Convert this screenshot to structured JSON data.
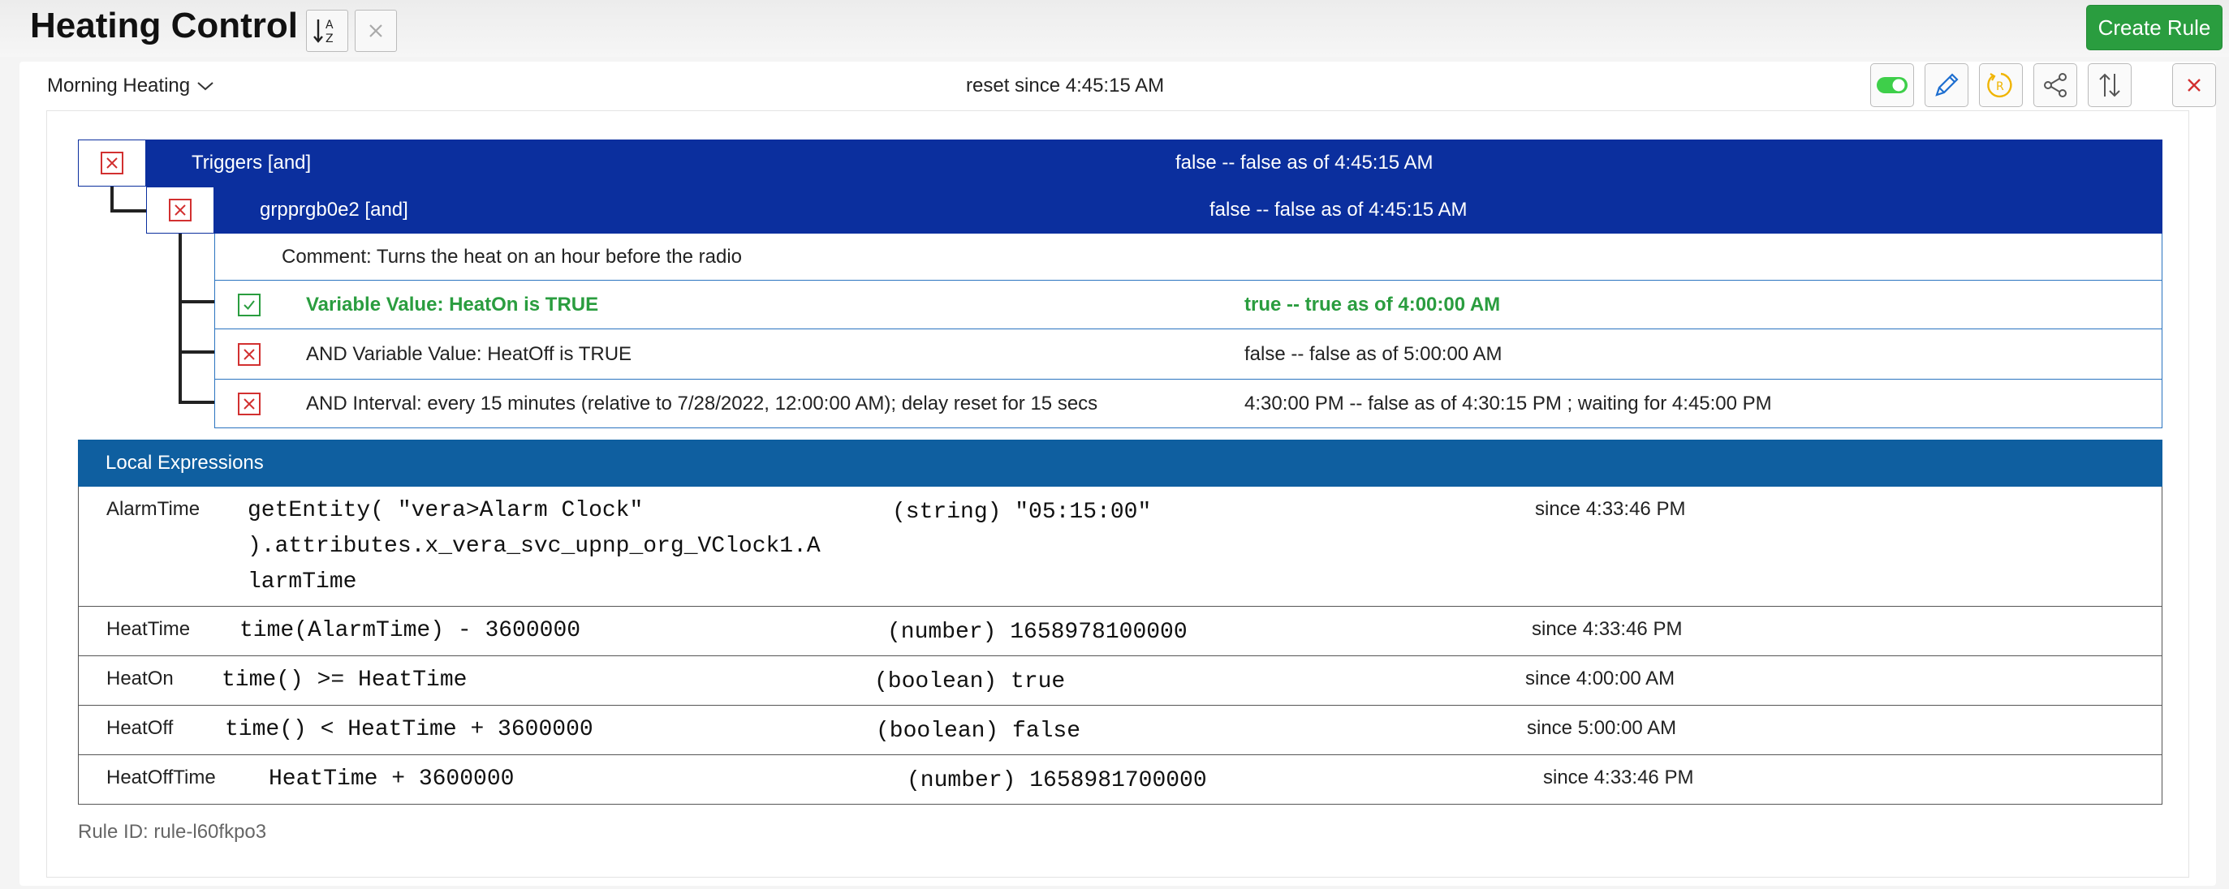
{
  "app": {
    "title": "Heating Control",
    "create_rule_label": "Create Rule"
  },
  "rule": {
    "name": "Morning Heating",
    "status": "reset since 4:45:15 AM",
    "id_text": "Rule ID: rule-l60fkpo3"
  },
  "triggers": {
    "root": {
      "label": "Triggers [and]",
      "state": "false -- false as of 4:45:15 AM"
    },
    "group": {
      "label": "grpprgb0e2 [and]",
      "state": "false -- false as of 4:45:15 AM"
    },
    "comment": "Comment: Turns the heat on an hour before the radio",
    "conditions": [
      {
        "label": "Variable Value: HeatOn is TRUE",
        "state": "true -- true as of 4:00:00 AM",
        "ok": true
      },
      {
        "label": "AND Variable Value: HeatOff is TRUE",
        "state": "false -- false as of 5:00:00 AM",
        "ok": false
      },
      {
        "label": "AND Interval: every 15 minutes (relative to 7/28/2022, 12:00:00 AM); delay reset for 15 secs",
        "state": "4:30:00 PM -- false as of 4:30:15 PM ; waiting for 4:45:00 PM",
        "ok": false
      }
    ]
  },
  "local_expressions": {
    "header": "Local Expressions",
    "rows": [
      {
        "name": "AlarmTime",
        "expr_lines": [
          "getEntity( \"vera>Alarm Clock\"",
          ").attributes.x_vera_svc_upnp_org_VClock1.A",
          "larmTime"
        ],
        "value": "(string) \"05:15:00\"",
        "since": "since 4:33:46 PM"
      },
      {
        "name": "HeatTime",
        "expr_lines": [
          "time(AlarmTime) - 3600000"
        ],
        "value": "(number) 1658978100000",
        "since": "since 4:33:46 PM"
      },
      {
        "name": "HeatOn",
        "expr_lines": [
          "time() >= HeatTime"
        ],
        "value": "(boolean) true",
        "since": "since 4:00:00 AM"
      },
      {
        "name": "HeatOff",
        "expr_lines": [
          "time() < HeatTime + 3600000"
        ],
        "value": "(boolean) false",
        "since": "since 5:00:00 AM"
      },
      {
        "name": "HeatOffTime",
        "expr_lines": [
          "HeatTime + 3600000"
        ],
        "value": "(number) 1658981700000",
        "since": "since 4:33:46 PM"
      }
    ]
  },
  "colors": {
    "trigger_blue": "#0b2f9e",
    "expr_blue": "#0f5fa0",
    "create_green": "#2a9d3f",
    "error_red": "#d23030"
  }
}
